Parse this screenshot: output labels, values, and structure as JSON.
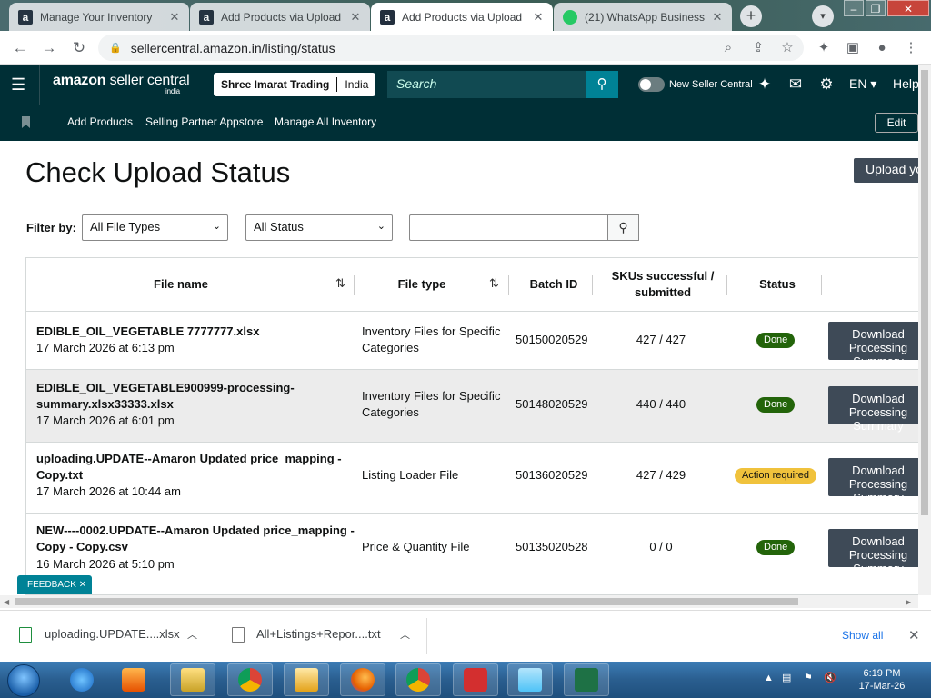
{
  "browser": {
    "tabs": [
      {
        "title": "Manage Your Inventory",
        "favicon": "amazon-icon",
        "active": false
      },
      {
        "title": "Add Products via Upload",
        "favicon": "amazon-icon",
        "active": false
      },
      {
        "title": "Add Products via Upload",
        "favicon": "amazon-icon",
        "active": true
      },
      {
        "title": "(21) WhatsApp Business",
        "favicon": "whatsapp-icon",
        "active": false
      }
    ],
    "url": "sellercentral.amazon.in/listing/status"
  },
  "header": {
    "logo_text": "amazon",
    "logo_sub": "seller central",
    "logo_region": "india",
    "store_name": "Shree Imarat Trading",
    "store_region": "India",
    "search_placeholder": "Search",
    "toggle_label": "New Seller Central",
    "language": "EN",
    "help": "Help"
  },
  "subnav": {
    "links": [
      "Add Products",
      "Selling Partner Appstore",
      "Manage All Inventory"
    ],
    "edit_label": "Edit"
  },
  "page": {
    "title": "Check Upload Status",
    "upload_button": "Upload yo",
    "filter_label": "Filter by:",
    "file_type_select": "All File Types",
    "status_select": "All Status"
  },
  "table": {
    "columns": [
      "File name",
      "File type",
      "Batch ID",
      "SKUs successful / submitted",
      "Status"
    ],
    "rows": [
      {
        "file_name": "EDIBLE_OIL_VEGETABLE 7777777.xlsx",
        "date": "17 March 2026 at 6:13 pm",
        "file_type": "Inventory Files for Specific Categories",
        "batch_id": "50150020529",
        "skus": "427 / 427",
        "status": "Done",
        "status_kind": "done",
        "action": "Download Processing Summary"
      },
      {
        "file_name": "EDIBLE_OIL_VEGETABLE900999-processing-summary.xlsx33333.xlsx",
        "date": "17 March 2026 at 6:01 pm",
        "file_type": "Inventory Files for Specific Categories",
        "batch_id": "50148020529",
        "skus": "440 / 440",
        "status": "Done",
        "status_kind": "done",
        "action": "Download Processing Summary"
      },
      {
        "file_name": "uploading.UPDATE--Amaron Updated price_mapping - Copy.txt",
        "date": "17 March 2026 at 10:44 am",
        "file_type": "Listing Loader File",
        "batch_id": "50136020529",
        "skus": "427 / 429",
        "status": "Action required",
        "status_kind": "action",
        "action": "Download Processing Summary"
      },
      {
        "file_name": "NEW----0002.UPDATE--Amaron Updated price_mapping - Copy - Copy.csv",
        "date": "16 March 2026 at 5:10 pm",
        "file_type": "Price & Quantity File",
        "batch_id": "50135020528",
        "skus": "0 / 0",
        "status": "Done",
        "status_kind": "done",
        "action": "Download Processing Summary"
      }
    ]
  },
  "feedback_label": "FEEDBACK",
  "downloads": {
    "items": [
      "uploading.UPDATE....xlsx",
      "All+Listings+Repor....txt"
    ],
    "show_all": "Show all"
  },
  "taskbar": {
    "time": "6:19 PM",
    "date": "17-Mar-26"
  }
}
